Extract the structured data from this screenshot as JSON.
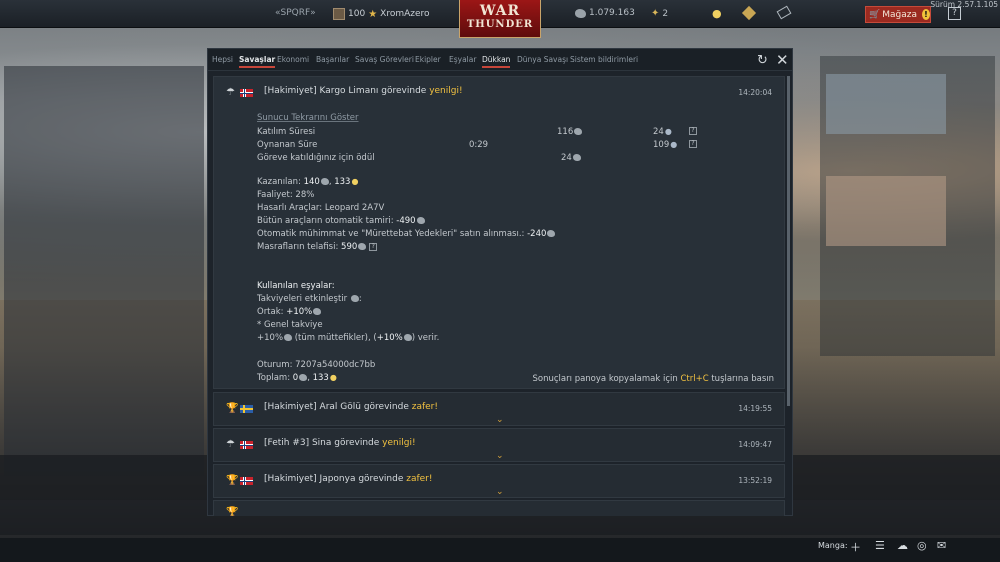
{
  "topbar": {
    "squad": "«SPQRF»",
    "level": "100",
    "username": "XromAzero",
    "logo_line1": "WAR",
    "logo_line2": "THUNDER",
    "silver": "1.079.163",
    "gold": "2",
    "shop_label": "Mağaza",
    "version": "Sürüm 2.57.1.105"
  },
  "tabs": [
    "Hepsi",
    "Savaşlar",
    "Ekonomi",
    "Başarılar",
    "Savaş Görevleri",
    "Ekipler",
    "Eşyalar",
    "Dükkan",
    "Dünya Savaşı",
    "Sistem bildirimleri"
  ],
  "expanded": {
    "title_prefix": "[Hakimiyet] Kargo Limanı görevinde ",
    "result": "yenilgi!",
    "time": "14:20:04",
    "replay_link": "Sunucu Tekrarını Göster",
    "rows": [
      {
        "label": "Katılım Süresi",
        "time": "",
        "silver": "116",
        "rp": "24"
      },
      {
        "label": "Oynanan Süre",
        "time": "0:29",
        "silver": "",
        "rp": "109"
      },
      {
        "label": "Göreve katıldığınız için ödül",
        "time": "",
        "silver": "24",
        "rp": ""
      }
    ],
    "earned_label": "Kazanılan: ",
    "earned_silver": "140",
    "earned_rp": "133",
    "activity": "Faaliyet: 28%",
    "damaged": "Hasarlı Araçlar: Leopard 2A7V",
    "repair_label": "Bütün araçların otomatik tamiri: ",
    "repair_value": "-490",
    "ammo_label": "Otomatik mühimmat ve \"Mürettebat Yedekleri\" satın alınması.: ",
    "ammo_value": "-240",
    "comp_label": "Masrafların telafisi: ",
    "comp_value": "590",
    "items_title": "Kullanılan eşyalar:",
    "boost_label": "Takviyeleri etkinleştir ",
    "common_label": "Ortak: ",
    "common_value": "+10%",
    "general": "* Genel takviye",
    "general_detail_a": "+10%",
    "general_detail_b": " (tüm müttefikler), (",
    "general_detail_c": "+10%",
    "general_detail_d": ") verir.",
    "session": "Oturum: 7207a54000dc7bb",
    "total_label": "Toplam: ",
    "total_silver": "0",
    "total_rp": "133",
    "hint_prefix": "Sonuçları panoya kopyalamak için ",
    "hint_key": "Ctrl+C",
    "hint_suffix": " tuşlarına basın"
  },
  "messages": [
    {
      "title_prefix": "[Hakimiyet] Aral Gölü görevinde ",
      "result": "zafer!",
      "time": "14:19:55"
    },
    {
      "title_prefix": "[Fetih #3] Sina görevinde ",
      "result": "yenilgi!",
      "time": "14:09:47"
    },
    {
      "title_prefix": "[Hakimiyet] Japonya görevinde ",
      "result": "zafer!",
      "time": "13:52:19"
    }
  ],
  "bottom": {
    "manga_label": "Manga:"
  },
  "colors": {
    "accent": "#c7463a",
    "result": "#f0c040",
    "panel": "#1d232a"
  }
}
